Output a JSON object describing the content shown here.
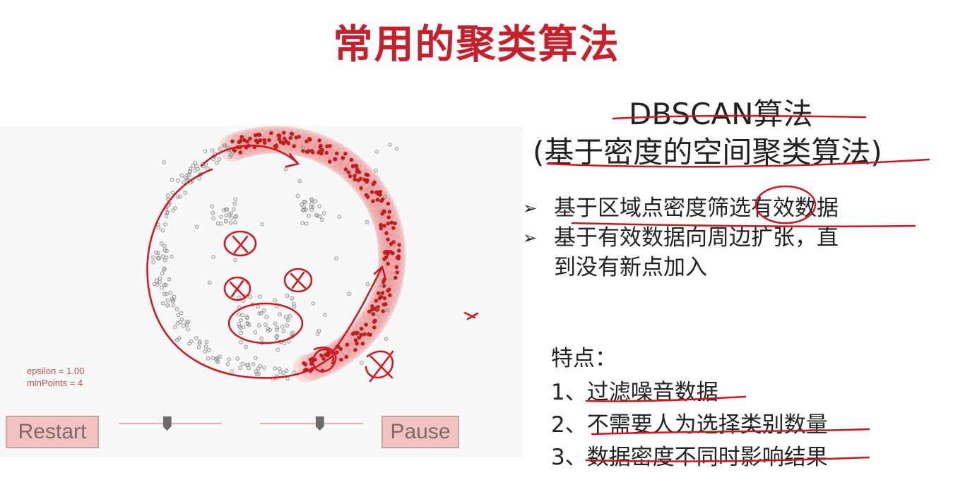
{
  "title": "常用的聚类算法",
  "demo": {
    "epsilon_label": "epsilon = 1.00",
    "minpoints_label": "minPoints = 4",
    "restart_label": "Restart",
    "pause_label": "Pause",
    "epsilon_slider_fraction": 0.47,
    "minpoints_slider_fraction": 0.58
  },
  "algorithm": {
    "name": "DBSCAN算法",
    "subtitle": "(基于密度的空间聚类算法)"
  },
  "bullets": [
    {
      "marker": "➢",
      "text": "基于区域点密度筛选有效数据"
    },
    {
      "marker": "➢",
      "text": "基于有效数据向周边扩张，直"
    },
    {
      "marker": "",
      "text": "到没有新点加入"
    }
  ],
  "features": {
    "heading": "特点：",
    "items": [
      "1、过滤噪音数据",
      "2、不需要人为选择类别数量",
      "3、数据密度不同时影响结果"
    ]
  },
  "colors": {
    "accent": "#c8202a",
    "point": "#8e8e8e",
    "cluster_point": "#c21d1d",
    "halo": "#e36a6a",
    "ink": "#d4141c"
  }
}
